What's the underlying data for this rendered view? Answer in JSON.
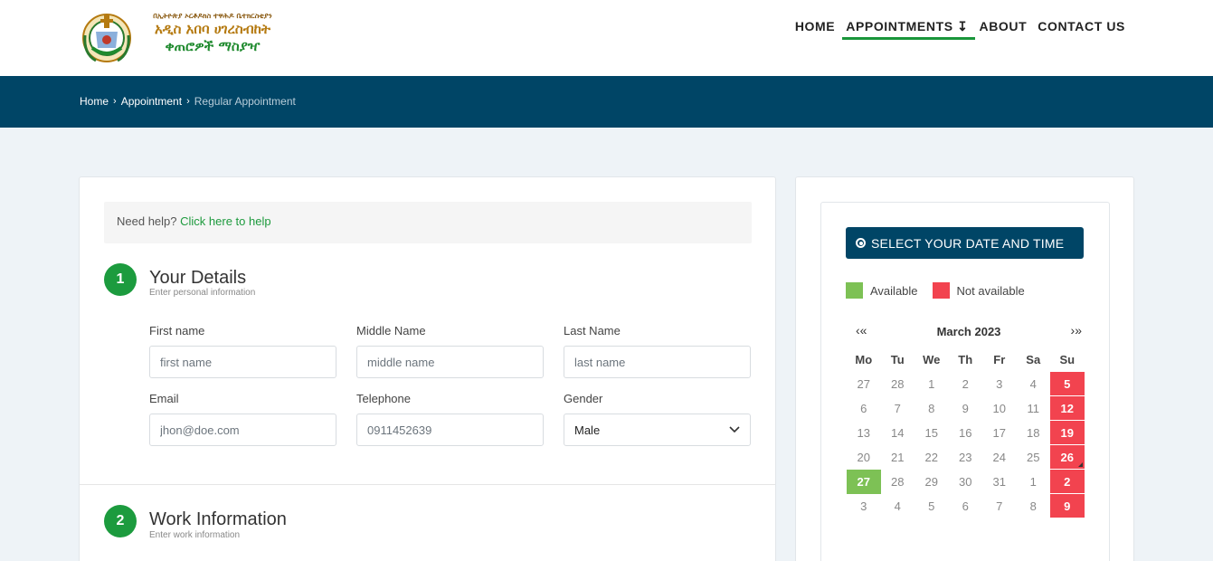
{
  "header": {
    "logo": {
      "line1": "በኢትዮጵያ ኦርቶዶክስ ተዋሕዶ ቤተክርስቲያን",
      "line2": "አዲስ አበባ ሀገረስብከት",
      "line3": "ቀጠሮዎች ማስያዣ"
    },
    "nav": [
      {
        "label": "HOME"
      },
      {
        "label": "APPOINTMENTS ↧"
      },
      {
        "label": "ABOUT"
      },
      {
        "label": "CONTACT US"
      }
    ]
  },
  "breadcrumb": {
    "items": [
      "Home",
      "Appointment",
      "Regular Appointment"
    ],
    "separator": "›"
  },
  "help": {
    "text": "Need help?",
    "link": "Click here to help"
  },
  "section1": {
    "number": "1",
    "title": "Your Details",
    "subtitle": "Enter personal information",
    "fields": {
      "first_name": {
        "label": "First name",
        "placeholder": "first name"
      },
      "middle_name": {
        "label": "Middle Name",
        "placeholder": "middle name"
      },
      "last_name": {
        "label": "Last Name",
        "placeholder": "last name"
      },
      "email": {
        "label": "Email",
        "placeholder": "jhon@doe.com"
      },
      "telephone": {
        "label": "Telephone",
        "placeholder": "0911452639"
      },
      "gender": {
        "label": "Gender",
        "value": "Male"
      }
    }
  },
  "section2": {
    "number": "2",
    "title": "Work Information",
    "subtitle": "Enter work information"
  },
  "sidebar": {
    "button_label": "SELECT YOUR DATE AND TIME",
    "legend": {
      "available": "Available",
      "not_available": "Not available"
    },
    "colors": {
      "available": "#7dc155",
      "not_available": "#f2434f",
      "primary": "#004566",
      "accent": "#1c9b3e"
    },
    "calendar": {
      "title": "March 2023",
      "prev": "‹«",
      "next": "›»",
      "weekdays": [
        "Mo",
        "Tu",
        "We",
        "Th",
        "Fr",
        "Sa",
        "Su"
      ],
      "weeks": [
        [
          {
            "d": "27"
          },
          {
            "d": "28"
          },
          {
            "d": "1"
          },
          {
            "d": "2"
          },
          {
            "d": "3"
          },
          {
            "d": "4"
          },
          {
            "d": "5",
            "s": "na"
          }
        ],
        [
          {
            "d": "6"
          },
          {
            "d": "7"
          },
          {
            "d": "8"
          },
          {
            "d": "9"
          },
          {
            "d": "10"
          },
          {
            "d": "11"
          },
          {
            "d": "12",
            "s": "na"
          }
        ],
        [
          {
            "d": "13"
          },
          {
            "d": "14"
          },
          {
            "d": "15"
          },
          {
            "d": "16"
          },
          {
            "d": "17"
          },
          {
            "d": "18"
          },
          {
            "d": "19",
            "s": "na"
          }
        ],
        [
          {
            "d": "20"
          },
          {
            "d": "21"
          },
          {
            "d": "22"
          },
          {
            "d": "23"
          },
          {
            "d": "24"
          },
          {
            "d": "25"
          },
          {
            "d": "26",
            "s": "na",
            "today": true
          }
        ],
        [
          {
            "d": "27",
            "s": "av"
          },
          {
            "d": "28"
          },
          {
            "d": "29"
          },
          {
            "d": "30"
          },
          {
            "d": "31"
          },
          {
            "d": "1"
          },
          {
            "d": "2",
            "s": "na"
          }
        ],
        [
          {
            "d": "3"
          },
          {
            "d": "4"
          },
          {
            "d": "5"
          },
          {
            "d": "6"
          },
          {
            "d": "7"
          },
          {
            "d": "8"
          },
          {
            "d": "9",
            "s": "na"
          }
        ]
      ]
    }
  }
}
